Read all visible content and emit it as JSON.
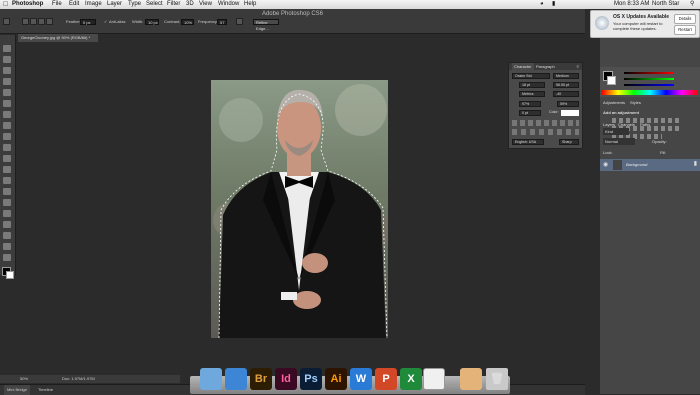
{
  "menubar": {
    "items": [
      "Photoshop",
      "File",
      "Edit",
      "Image",
      "Layer",
      "Type",
      "Select",
      "Filter",
      "3D",
      "View",
      "Window",
      "Help"
    ],
    "clock": "Mon 8:33 AM",
    "user": "North Star"
  },
  "window": {
    "title": "Adobe Photoshop CS6"
  },
  "options": {
    "feather_label": "Feather:",
    "feather_value": "0 px",
    "antialias_label": "Anti-alias",
    "width_label": "Width:",
    "width_value": "10 px",
    "contrast_label": "Contrast:",
    "contrast_value": "10%",
    "frequency_label": "Frequency:",
    "frequency_value": "57",
    "refine_label": "Refine Edge..."
  },
  "document": {
    "tab": "GeorgeClooney.jpg @ 50% (RGB/8#) *"
  },
  "status": {
    "zoom": "50%",
    "doc": "Doc: 1.97M/1.97M"
  },
  "bottom_tabs": [
    "Mini Bridge",
    "Timeline"
  ],
  "notification": {
    "title": "OS X Updates Available",
    "body": "Your computer will restart to complete these updates.",
    "details": "Details",
    "restart": "Restart"
  },
  "character_panel": {
    "tabs": [
      "Character",
      "Paragraph"
    ],
    "font": "Orator Std",
    "style": "Medium",
    "size": "18 pt",
    "leading": "56.55 pt",
    "kerning": "Metrics",
    "tracking": "-40",
    "vscale": "97%",
    "hscale": "59%",
    "baseline": "0 pt",
    "color_label": "Color:",
    "language": "English: USA",
    "aa": "Sharp"
  },
  "right_panels": {
    "color_tabs": [
      "Color",
      "Swatches"
    ],
    "adjust_tabs": [
      "Adjustments",
      "Styles"
    ],
    "adjust_title": "Add an adjustment",
    "layer_tabs": [
      "Layers",
      "Channels",
      "Paths"
    ],
    "kind": "Kind",
    "blend": "Normal",
    "opacity_label": "Opacity:",
    "lock_label": "Lock:",
    "fill_label": "Fill:",
    "layer_name": "Background"
  },
  "dock": {
    "apps": [
      {
        "name": "Finder",
        "label": "",
        "color": "#6fa8dc"
      },
      {
        "name": "Safari",
        "label": "",
        "color": "#3d86d6"
      },
      {
        "name": "Bridge",
        "label": "Br",
        "color": "#2d1d05"
      },
      {
        "name": "InDesign",
        "label": "Id",
        "color": "#3a0a23"
      },
      {
        "name": "Photoshop",
        "label": "Ps",
        "color": "#0b1d35"
      },
      {
        "name": "Illustrator",
        "label": "Ai",
        "color": "#2c1401"
      },
      {
        "name": "Word",
        "label": "W",
        "color": "#2a7bd6"
      },
      {
        "name": "PowerPoint",
        "label": "P",
        "color": "#d24726"
      },
      {
        "name": "Excel",
        "label": "X",
        "color": "#1e8a3a"
      }
    ]
  },
  "colors": {
    "accent": "#3d86d6",
    "panel": "#464646",
    "workspace": "#2b2b2b"
  }
}
